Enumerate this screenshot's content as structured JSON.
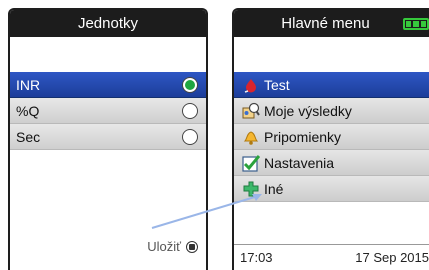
{
  "left_screen": {
    "title": "Jednotky",
    "options": [
      {
        "label": "INR",
        "selected": true
      },
      {
        "label": "%Q",
        "selected": false
      },
      {
        "label": "Sec",
        "selected": false
      }
    ],
    "save_label": "Uložiť"
  },
  "right_screen": {
    "title": "Hlavné menu",
    "menu": [
      {
        "label": "Test",
        "icon": "test-drop-icon",
        "selected": true
      },
      {
        "label": "Moje výsledky",
        "icon": "results-icon",
        "selected": false
      },
      {
        "label": "Pripomienky",
        "icon": "reminder-bell-icon",
        "selected": false
      },
      {
        "label": "Nastavenia",
        "icon": "settings-check-icon",
        "selected": false
      },
      {
        "label": "Iné",
        "icon": "other-puzzle-icon",
        "selected": false
      }
    ],
    "time": "17:03",
    "date": "17 Sep 2015"
  },
  "colors": {
    "selection": "#2e57c4",
    "radio_checked": "#1fa640",
    "battery": "#36c93c",
    "pointer_line": "#9ab6e8"
  }
}
